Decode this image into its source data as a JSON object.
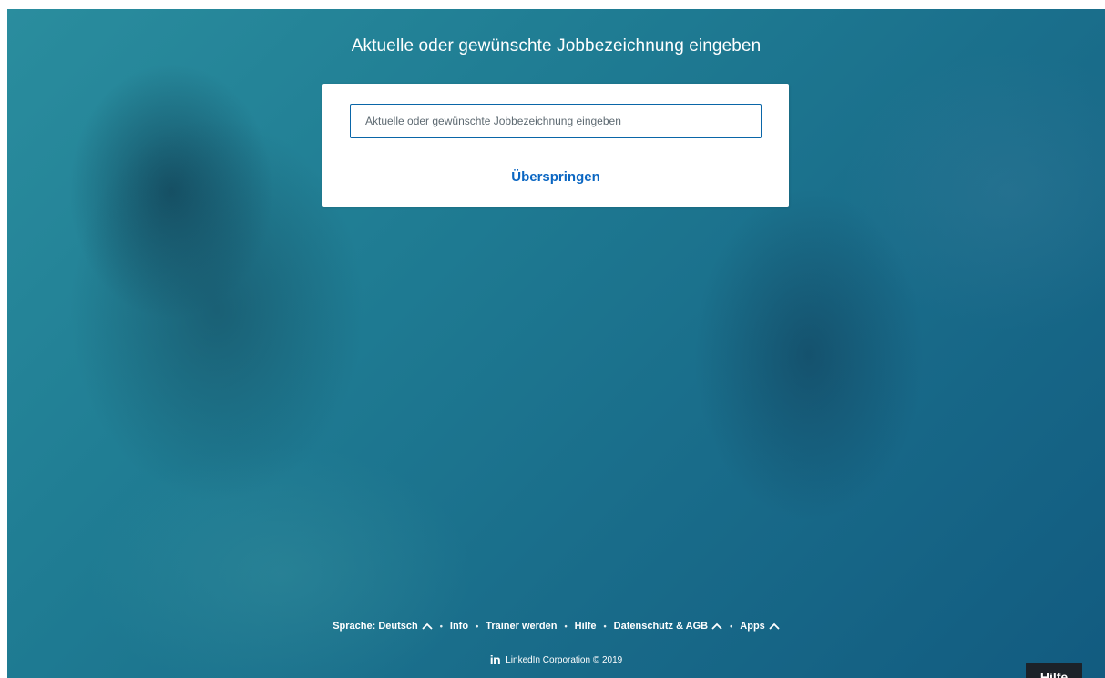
{
  "hero": {
    "title": "Aktuelle oder gewünschte Jobbezeichnung eingeben"
  },
  "form": {
    "job_input_placeholder": "Aktuelle oder gewünschte Jobbezeichnung eingeben",
    "job_input_value": "",
    "skip_label": "Überspringen"
  },
  "footer": {
    "links": [
      {
        "label": "Sprache: Deutsch",
        "has_caret": true
      },
      {
        "label": "Info",
        "has_caret": false
      },
      {
        "label": "Trainer werden",
        "has_caret": false
      },
      {
        "label": "Hilfe",
        "has_caret": false
      },
      {
        "label": "Datenschutz & AGB",
        "has_caret": true
      },
      {
        "label": "Apps",
        "has_caret": true
      }
    ],
    "separator": "•",
    "logo_icon": "linkedin-logo-icon",
    "logo_text": "in",
    "copyright": "LinkedIn Corporation © 2019"
  },
  "help_button": {
    "label": "Hilfe"
  },
  "colors": {
    "background_start": "#2a8d9e",
    "background_end": "#125b80",
    "link_blue": "#0a66c2",
    "help_button_bg": "#1c2229"
  }
}
